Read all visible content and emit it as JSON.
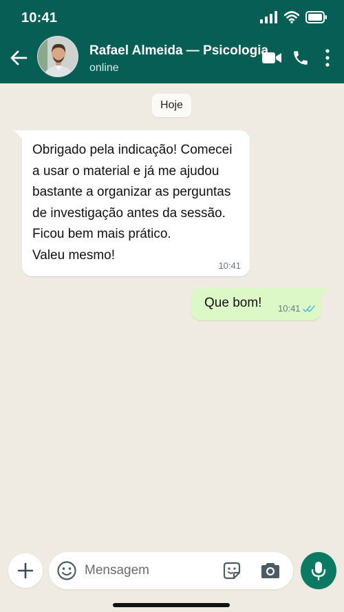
{
  "status_bar": {
    "time": "10:41"
  },
  "header": {
    "contact_name": "Rafael Almeida — Psicologia",
    "contact_status": "online",
    "colors": {
      "bar": "#075e54"
    }
  },
  "chat": {
    "date_chip": "Hoje",
    "messages": [
      {
        "direction": "incoming",
        "lines": [
          "Obrigado pela indicação! Comecei",
          "a usar o material e já me ajudou",
          "bastante a organizar as perguntas",
          "de investigação antes da sessão.",
          "Ficou bem mais prático.",
          "Valeu mesmo!"
        ],
        "time": "10:41"
      },
      {
        "direction": "outgoing",
        "text": "Que bom!",
        "time": "10:41",
        "status": "read"
      }
    ],
    "colors": {
      "background": "#efeae2",
      "incoming": "#ffffff",
      "outgoing": "#dcf8c6",
      "read_ticks": "#53bdeb"
    }
  },
  "composer": {
    "placeholder": "Mensagem",
    "icons": [
      "plus-icon",
      "emoji-icon",
      "sticker-icon",
      "camera-icon",
      "mic-icon"
    ],
    "colors": {
      "mic_button": "#0b7a63"
    }
  }
}
